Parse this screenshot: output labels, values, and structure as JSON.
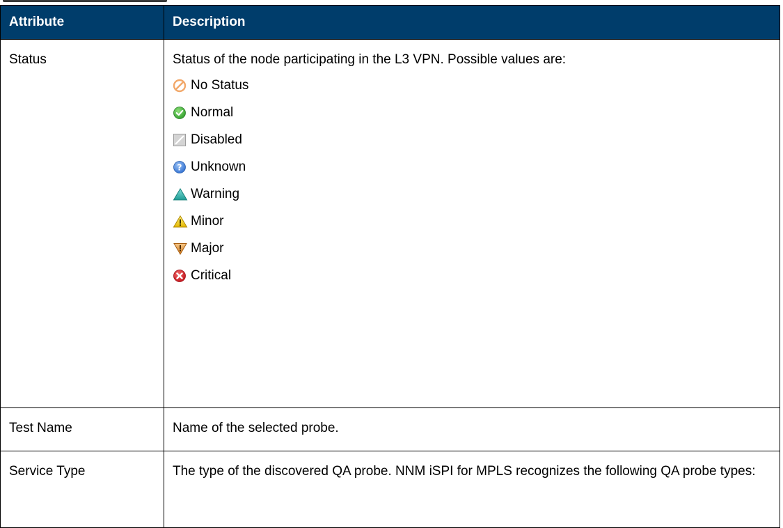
{
  "table": {
    "headers": {
      "attribute": "Attribute",
      "description": "Description"
    },
    "rows": {
      "status": {
        "attribute": "Status",
        "description": "Status of the node participating in the L3 VPN. Possible values are:",
        "values": [
          {
            "label": "No Status",
            "icon": "no-status-icon"
          },
          {
            "label": "Normal",
            "icon": "normal-icon"
          },
          {
            "label": "Disabled",
            "icon": "disabled-icon"
          },
          {
            "label": "Unknown",
            "icon": "unknown-icon"
          },
          {
            "label": "Warning",
            "icon": "warning-icon"
          },
          {
            "label": "Minor",
            "icon": "minor-icon"
          },
          {
            "label": "Major",
            "icon": "major-icon"
          },
          {
            "label": "Critical",
            "icon": "critical-icon"
          }
        ]
      },
      "test_name": {
        "attribute": "Test Name",
        "description": "Name of the selected probe."
      },
      "service_type": {
        "attribute": "Service Type",
        "description": "The type of the discovered QA probe. NNM iSPI for MPLS  recognizes the following QA probe types:"
      }
    }
  },
  "colors": {
    "header_bg": "#003d6b",
    "header_text": "#ffffff",
    "border": "#000000"
  }
}
